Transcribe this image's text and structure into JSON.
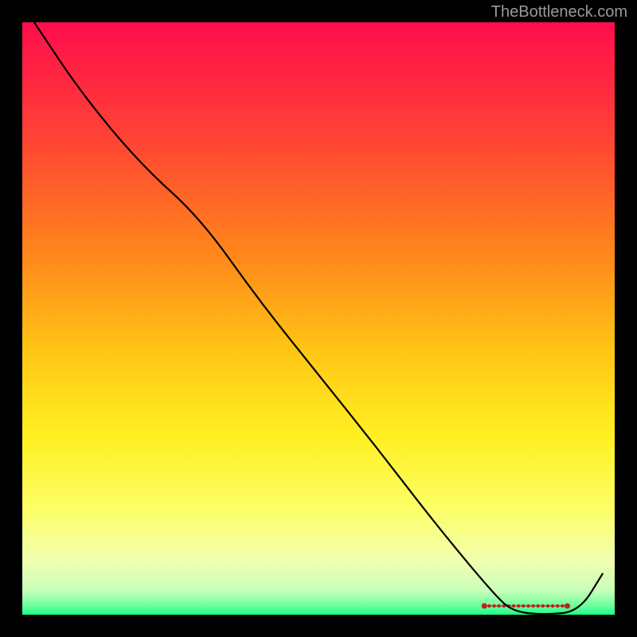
{
  "watermark": "TheBottleneck.com",
  "chart_data": {
    "type": "line",
    "title": "",
    "xlabel": "",
    "ylabel": "",
    "xlim": [
      0,
      100
    ],
    "ylim": [
      0,
      100
    ],
    "grid": false,
    "series": [
      {
        "name": "curve",
        "color": "#000000",
        "x": [
          2,
          10,
          20,
          30,
          40,
          50,
          60,
          70,
          80,
          83,
          88,
          94,
          98
        ],
        "y": [
          100,
          88,
          76,
          67,
          53,
          40.5,
          28,
          15,
          3,
          0.5,
          0,
          0.5,
          7
        ]
      }
    ],
    "highlight_band": {
      "x_start": 78,
      "x_end": 92,
      "color": "#c02020"
    },
    "gradient_stops": [
      {
        "offset": 0.0,
        "color": "#ff0d4d"
      },
      {
        "offset": 0.2,
        "color": "#ff4433"
      },
      {
        "offset": 0.4,
        "color": "#ff8a1a"
      },
      {
        "offset": 0.55,
        "color": "#ffc414"
      },
      {
        "offset": 0.7,
        "color": "#fff022"
      },
      {
        "offset": 0.82,
        "color": "#fdff66"
      },
      {
        "offset": 0.91,
        "color": "#f0ffb0"
      },
      {
        "offset": 0.96,
        "color": "#c7ffb9"
      },
      {
        "offset": 0.985,
        "color": "#6aff9c"
      },
      {
        "offset": 1.0,
        "color": "#1aff88"
      }
    ]
  }
}
